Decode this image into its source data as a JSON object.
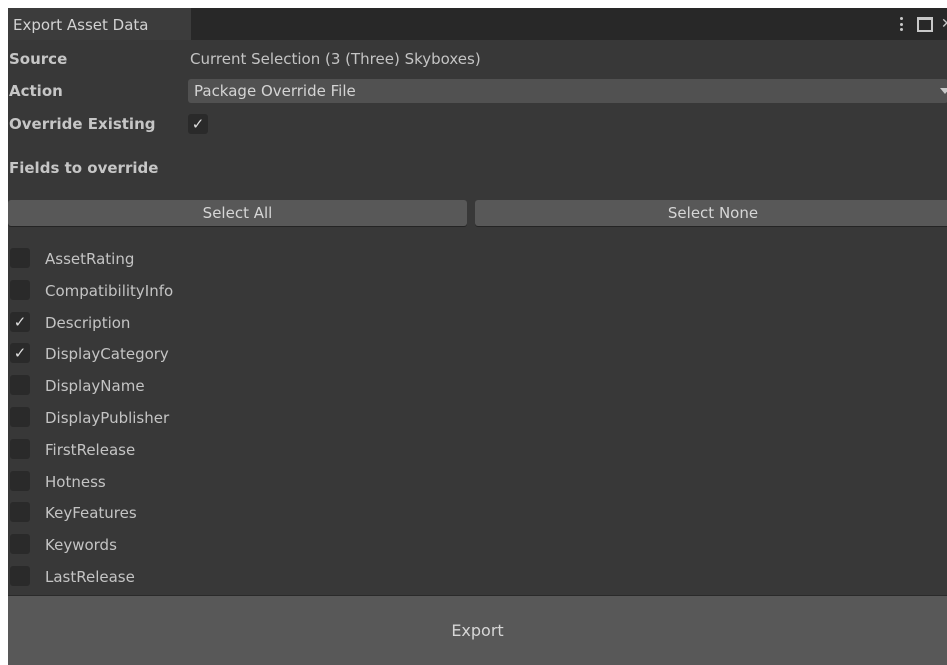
{
  "window": {
    "tab_title": "Export Asset Data"
  },
  "source": {
    "label": "Source",
    "value": "Current Selection (3 (Three) Skyboxes)"
  },
  "action": {
    "label": "Action",
    "selected": "Package Override File"
  },
  "override_existing": {
    "label": "Override Existing",
    "checked": true,
    "check_glyph": "✓"
  },
  "fields_section": {
    "label": "Fields to override",
    "select_all_label": "Select All",
    "select_none_label": "Select None",
    "fields": [
      {
        "name": "AssetRating",
        "checked": false
      },
      {
        "name": "CompatibilityInfo",
        "checked": false
      },
      {
        "name": "Description",
        "checked": true
      },
      {
        "name": "DisplayCategory",
        "checked": true
      },
      {
        "name": "DisplayName",
        "checked": false
      },
      {
        "name": "DisplayPublisher",
        "checked": false
      },
      {
        "name": "FirstRelease",
        "checked": false
      },
      {
        "name": "Hotness",
        "checked": false
      },
      {
        "name": "KeyFeatures",
        "checked": false
      },
      {
        "name": "Keywords",
        "checked": false
      },
      {
        "name": "LastRelease",
        "checked": false
      }
    ]
  },
  "export": {
    "label": "Export"
  },
  "colors": {
    "panel_bg": "#383838",
    "titlebar_bg": "#282828",
    "button_bg": "#585858",
    "checkbox_bg": "#2a2a2a",
    "text": "#c4c4c4"
  },
  "icons": {
    "menu": "kebab-menu-icon",
    "maximize": "maximize-icon",
    "close": "close-icon",
    "dropdown": "triangle-down-icon",
    "check": "checkmark-icon"
  }
}
